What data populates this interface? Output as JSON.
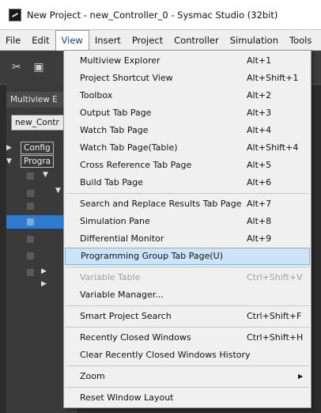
{
  "window": {
    "title": "New Project - new_Controller_0 - Sysmac Studio (32bit)"
  },
  "menubar": {
    "items": [
      "File",
      "Edit",
      "View",
      "Insert",
      "Project",
      "Controller",
      "Simulation",
      "Tools"
    ],
    "active": "View"
  },
  "left_pane": {
    "header": "Multiview E",
    "combo_value": "new_Contr",
    "tree": [
      "Config",
      "Progra"
    ]
  },
  "view_menu": {
    "items": [
      {
        "label": "Multiview Explorer",
        "shortcut": "Alt+1"
      },
      {
        "label": "Project Shortcut View",
        "shortcut": "Alt+Shift+1"
      },
      {
        "label": "Toolbox",
        "shortcut": "Alt+2"
      },
      {
        "label": "Output Tab Page",
        "shortcut": "Alt+3"
      },
      {
        "label": "Watch Tab Page",
        "shortcut": "Alt+4"
      },
      {
        "label": "Watch Tab Page(Table)",
        "shortcut": "Alt+Shift+4"
      },
      {
        "label": "Cross Reference Tab Page",
        "shortcut": "Alt+5"
      },
      {
        "label": "Build Tab Page",
        "shortcut": "Alt+6"
      },
      {
        "label": "Search and Replace Results Tab Page",
        "shortcut": "Alt+7"
      },
      {
        "label": "Simulation Pane",
        "shortcut": "Alt+8"
      },
      {
        "label": "Differential Monitor",
        "shortcut": "Alt+9"
      },
      {
        "label": "Programming Group Tab Page(U)",
        "shortcut": ""
      },
      {
        "label": "Variable Table",
        "shortcut": "Ctrl+Shift+V"
      },
      {
        "label": "Variable Manager...",
        "shortcut": ""
      },
      {
        "label": "Smart Project Search",
        "shortcut": "Ctrl+Shift+F"
      },
      {
        "label": "Recently Closed Windows",
        "shortcut": "Ctrl+Shift+H"
      },
      {
        "label": "Clear Recently Closed Windows History",
        "shortcut": ""
      },
      {
        "label": "Zoom",
        "shortcut": ""
      },
      {
        "label": "Reset Window Layout",
        "shortcut": ""
      }
    ],
    "highlighted": "Programming Group Tab Page(U)",
    "disabled": [
      "Variable Table"
    ]
  },
  "colors": {
    "highlight": "#cce4f7",
    "selection_blue": "#2e7bd0",
    "menu_bg": "#f0f0f0"
  }
}
